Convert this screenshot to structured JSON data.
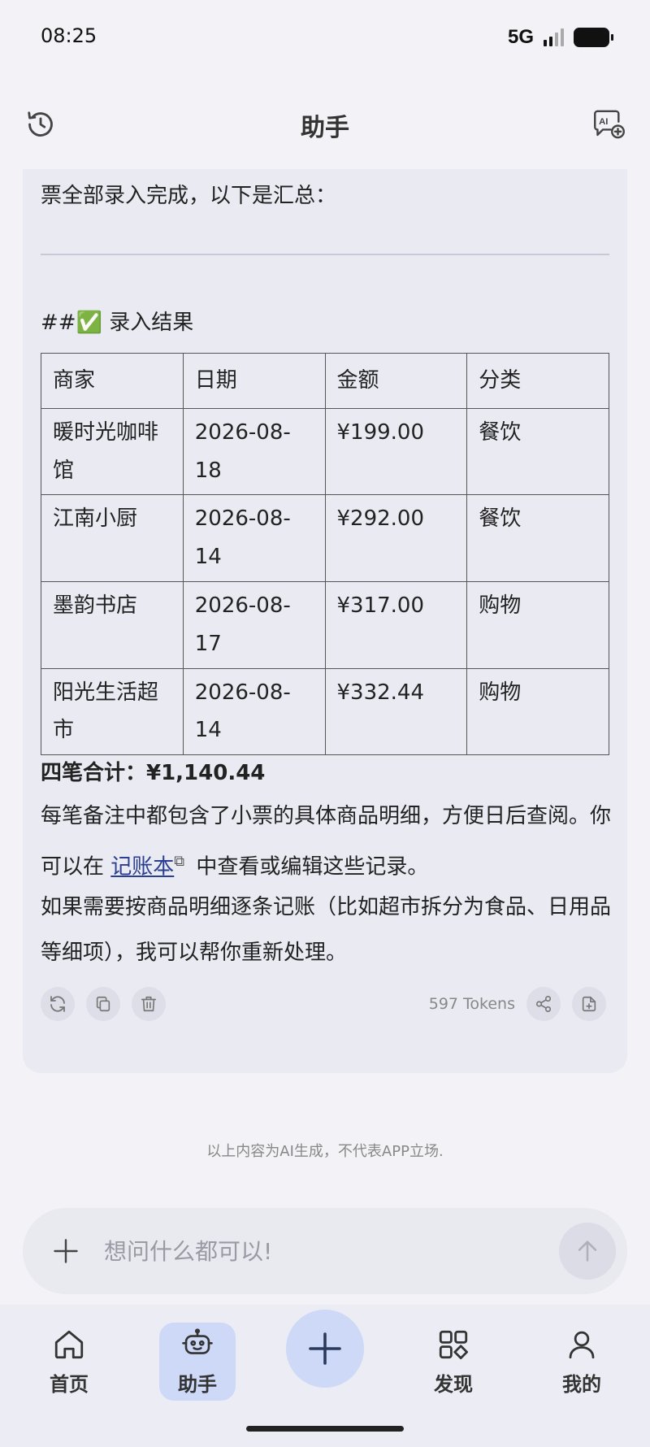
{
  "status_bar": {
    "time": "08:25",
    "network": "5G"
  },
  "header": {
    "title": "助手",
    "left_icon": "history-icon",
    "right_icon": "ai-chat-add-icon"
  },
  "message": {
    "intro": "票全部录入完成，以下是汇总：",
    "heading": "##✅ 录入结果",
    "table": {
      "headers": [
        "商家",
        "日期",
        "金额",
        "分类"
      ],
      "rows": [
        {
          "merchant": "暖时光咖啡馆",
          "date": "2026-08-18",
          "amount": "¥199.00",
          "category": "餐饮"
        },
        {
          "merchant": "江南小厨",
          "date": "2026-08-14",
          "amount": "¥292.00",
          "category": "餐饮"
        },
        {
          "merchant": "墨韵书店",
          "date": "2026-08-17",
          "amount": "¥317.00",
          "category": "购物"
        },
        {
          "merchant": "阳光生活超市",
          "date": "2026-08-14",
          "amount": "¥332.44",
          "category": "购物"
        }
      ]
    },
    "total": "四笔合计：¥1,140.44",
    "para1_before": "每笔备注中都包含了小票的具体商品明细，方便日后查阅。你可以在 ",
    "para1_link": "记账本",
    "para1_after": " 中查看或编辑这些记录。",
    "para2": "如果需要按商品明细逐条记账（比如超市拆分为食品、日用品等细项），我可以帮你重新处理。",
    "token_count": "597 Tokens"
  },
  "disclaimer": "以上内容为AI生成，不代表APP立场.",
  "input": {
    "placeholder": "想问什么都可以!"
  },
  "nav": {
    "home": "首页",
    "assistant": "助手",
    "discover": "发现",
    "mine": "我的"
  },
  "colors": {
    "accent_bg": "#cdd9f7",
    "link": "#2a3f8f",
    "card_bg": "#eaeaf2"
  }
}
